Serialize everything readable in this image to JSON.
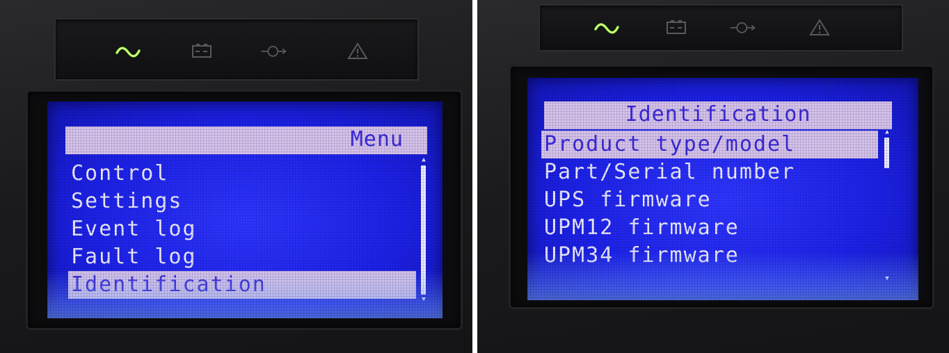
{
  "colors": {
    "lcd_background": "#1d22e8",
    "lcd_text": "#ecebff",
    "highlight_bar": "#d6c3ea",
    "highlight_text": "#3a2ad8",
    "housing": "#1b1b1e",
    "ac_led_active": "#9dff3a",
    "led_inactive": "#5a5a5e"
  },
  "indicators": {
    "ac_power_icon": "sine-wave-icon",
    "battery_icon": "battery-icon",
    "bypass_icon": "bypass-icon",
    "alarm_icon": "warning-triangle-icon",
    "ac_power_lit": true
  },
  "left_screen": {
    "title": "Menu",
    "items": [
      {
        "label": "Control",
        "selected": false
      },
      {
        "label": "Settings",
        "selected": false
      },
      {
        "label": "Event log",
        "selected": false
      },
      {
        "label": "Fault log",
        "selected": false
      },
      {
        "label": "Identification",
        "selected": true
      }
    ]
  },
  "right_screen": {
    "title": "Identification",
    "items": [
      {
        "label": "Product type/model",
        "selected": true
      },
      {
        "label": "Part/Serial number",
        "selected": false
      },
      {
        "label": "UPS firmware",
        "selected": false
      },
      {
        "label": "UPM12 firmware",
        "selected": false
      },
      {
        "label": "UPM34 firmware",
        "selected": false
      }
    ]
  }
}
